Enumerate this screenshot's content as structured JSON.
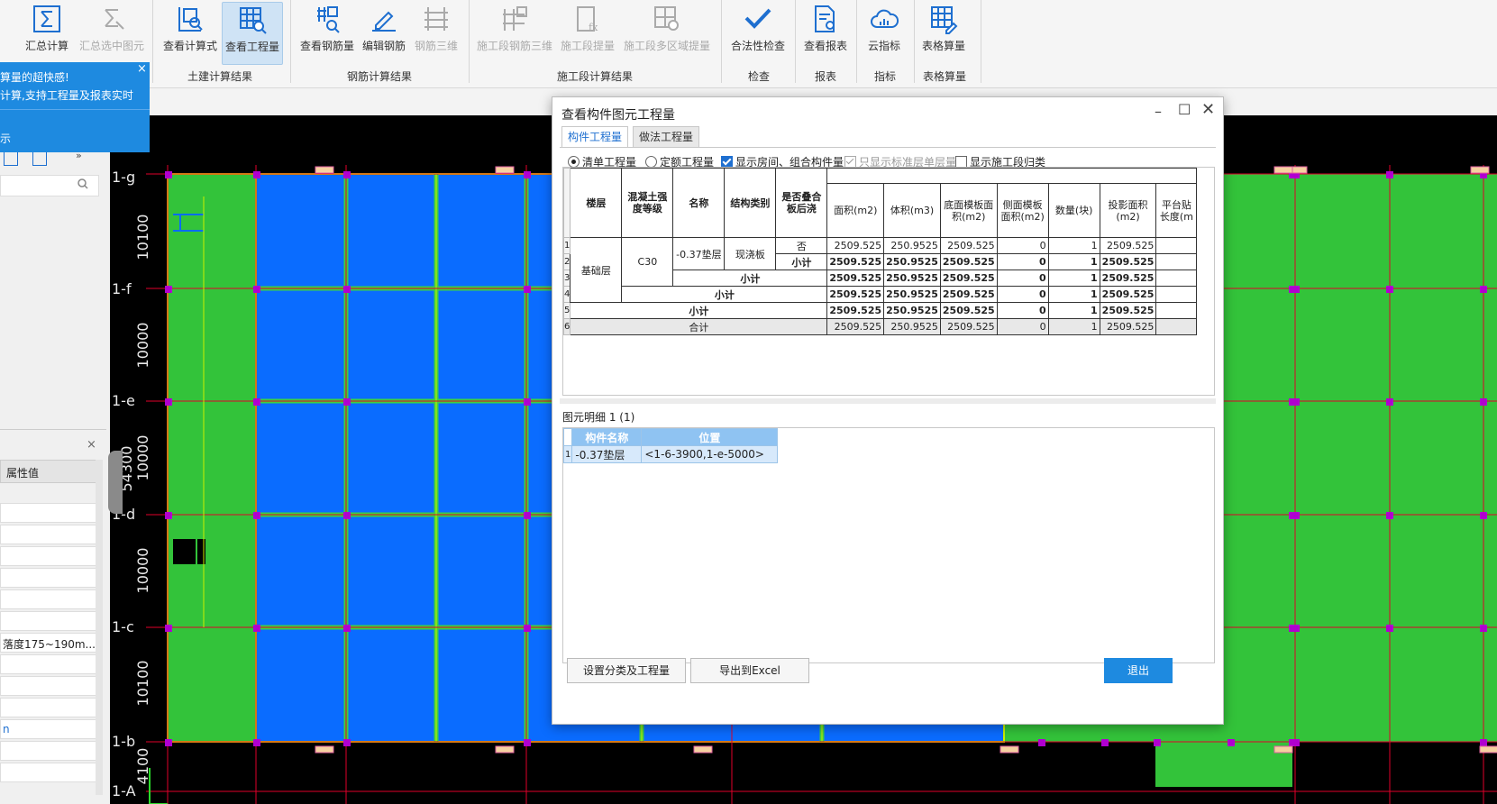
{
  "ribbon": {
    "buttons": [
      {
        "id": "sum",
        "label": "汇总计算",
        "disabled": false,
        "active": false
      },
      {
        "id": "sumsel",
        "label": "汇总选中图元",
        "disabled": true,
        "active": false
      },
      {
        "id": "calcform",
        "label": "查看计算式",
        "disabled": false,
        "active": false
      },
      {
        "id": "qty",
        "label": "查看工程量",
        "disabled": false,
        "active": true
      },
      {
        "id": "rebarqty",
        "label": "查看钢筋量",
        "disabled": false,
        "active": false
      },
      {
        "id": "editrebar",
        "label": "编辑钢筋",
        "disabled": false,
        "active": false
      },
      {
        "id": "rebar3d",
        "label": "钢筋三维",
        "disabled": true,
        "active": false
      },
      {
        "id": "stage3d",
        "label": "施工段钢筋三维",
        "disabled": true,
        "active": false
      },
      {
        "id": "stageqty",
        "label": "施工段提量",
        "disabled": true,
        "active": false
      },
      {
        "id": "stagemulti",
        "label": "施工段多区域提量",
        "disabled": true,
        "active": false
      },
      {
        "id": "check",
        "label": "合法性检查",
        "disabled": false,
        "active": false
      },
      {
        "id": "report",
        "label": "查看报表",
        "disabled": false,
        "active": false
      },
      {
        "id": "cloud",
        "label": "云指标",
        "disabled": false,
        "active": false
      },
      {
        "id": "table",
        "label": "表格算量",
        "disabled": false,
        "active": false
      }
    ],
    "groups": [
      "土建计算结果",
      "钢筋计算结果",
      "施工段计算结果",
      "检查",
      "报表",
      "指标",
      "表格算量"
    ]
  },
  "left": {
    "tip_line1": "算量的超快感!",
    "tip_line2": "计算,支持工程量及报表实时",
    "tip_line3": "示",
    "tip_close": "×",
    "dropdown_arrow": "▾",
    "prop_close": "×",
    "prop_header": "属性值",
    "prop_value": "落度175~190m...",
    "prop_value2": "n"
  },
  "canvas": {
    "axis_labels": [
      "1-g",
      "1-f",
      "1-e",
      "1-d",
      "1-c",
      "1-b",
      "1-A"
    ],
    "dims": [
      "10100",
      "10000",
      "10000",
      "10000",
      "10100",
      "4100"
    ],
    "total_dim": "54300"
  },
  "dialog": {
    "title": "查看构件图元工程量",
    "tabs": [
      "构件工程量",
      "做法工程量"
    ],
    "options": {
      "radio1": "清单工程量",
      "radio2": "定额工程量",
      "chk1": "显示房间、组合构件量",
      "chk2": "只显示标准层单层量",
      "chk3": "显示施工段归类"
    },
    "table": {
      "headers": [
        "楼层",
        "混凝土强度等级",
        "名称",
        "结构类别",
        "是否叠合板后浇",
        "面积(m2)",
        "体积(m3)",
        "底面模板面积(m2)",
        "侧面模板面积(m2)",
        "数量(块)",
        "投影面积(m2)",
        "平台贴长度(m"
      ],
      "row_nums": [
        "1",
        "2",
        "3",
        "4",
        "5",
        "6"
      ],
      "floor": "基础层",
      "grade": "C30",
      "name": "-0.37垫层",
      "struct": "现浇板",
      "stack": "否",
      "subtotal": "小计",
      "total": "合计",
      "values": {
        "area": "2509.525",
        "volume": "250.9525",
        "bottom": "2509.525",
        "side": "0",
        "count": "1",
        "proj": "2509.525"
      }
    },
    "detail": {
      "label": "图元明细",
      "count": "1 (1)",
      "headers": [
        "构件名称",
        "位置"
      ],
      "row_num": "1",
      "row_name": "-0.37垫层",
      "row_pos": "<1-6-3900,1-e-5000>"
    },
    "buttons": {
      "settings": "设置分类及工程量",
      "export": "导出到Excel",
      "exit": "退出"
    }
  }
}
